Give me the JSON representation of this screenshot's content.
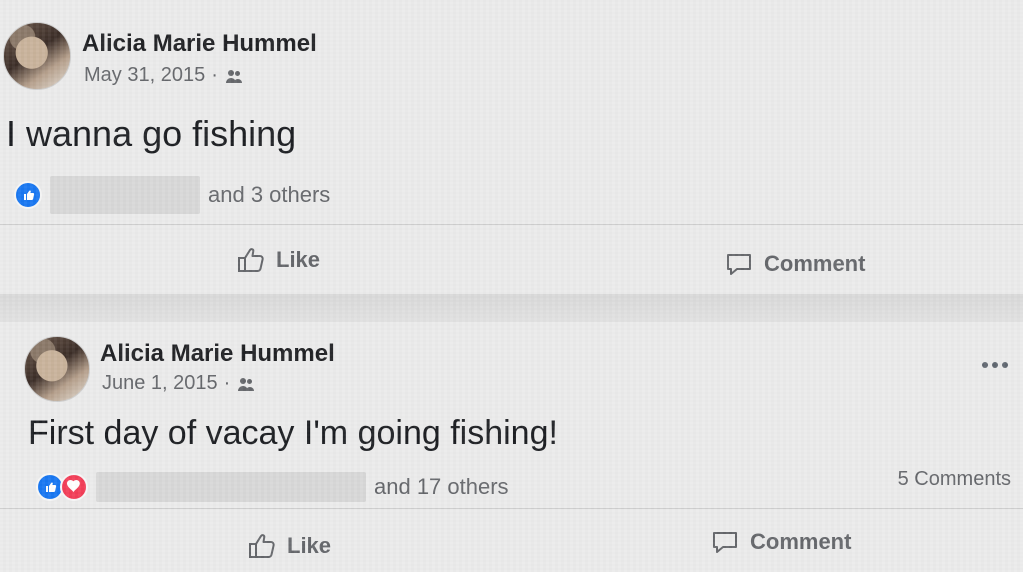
{
  "posts": [
    {
      "author": "Alicia Marie Hummel",
      "date": "May 31, 2015",
      "meta_separator": "·",
      "text": "I wanna go fishing",
      "reaction_summary": "and 3 others",
      "actions": {
        "like": "Like",
        "comment": "Comment"
      },
      "icons": {
        "avatar": "profile-photo",
        "audience": "friends-icon",
        "reaction_like": "like-reaction-icon",
        "like_action": "thumbs-up-icon",
        "comment_action": "comment-icon"
      }
    },
    {
      "author": "Alicia Marie Hummel",
      "date": "June 1, 2015",
      "meta_separator": "·",
      "text": "First day of vacay I'm going fishing!",
      "reaction_summary": "and 17 others",
      "comments_count": "5 Comments",
      "actions": {
        "like": "Like",
        "comment": "Comment"
      },
      "icons": {
        "avatar": "profile-photo",
        "audience": "friends-icon",
        "reaction_like": "like-reaction-icon",
        "reaction_love": "love-reaction-icon",
        "more": "more-options-icon",
        "like_action": "thumbs-up-icon",
        "comment_action": "comment-icon"
      }
    }
  ],
  "colors": {
    "background": "#dcdcdc",
    "card": "#ebebeb",
    "text_primary": "#1c1e21",
    "text_secondary": "#65676b",
    "like_blue": "#1877f2",
    "love_red": "#f33e58"
  }
}
